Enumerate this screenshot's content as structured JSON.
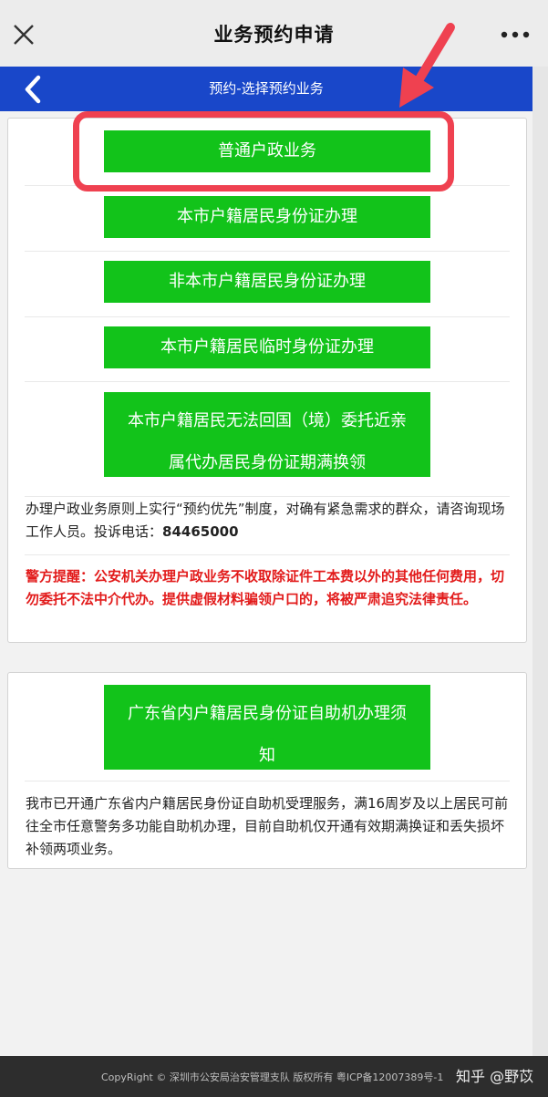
{
  "header": {
    "title": "业务预约申请",
    "close_icon": "close-icon",
    "more_icon": "more-icon"
  },
  "nav": {
    "title": "预约-选择预约业务",
    "back_icon": "chevron-left-icon",
    "background": "#1947c9"
  },
  "card1": {
    "buttons": [
      {
        "lines": [
          "普通户政业务"
        ]
      },
      {
        "lines": [
          "本市户籍居民身份证办理"
        ]
      },
      {
        "lines": [
          "非本市户籍居民身份证办理"
        ]
      },
      {
        "lines": [
          "本市户籍居民临时身份证办理"
        ]
      },
      {
        "lines": [
          "本市户籍居民无法回国（境）委托近亲",
          "属代办居民身份证期满换领"
        ]
      }
    ],
    "notice": "办理户政业务原则上实行“预约优先”制度，对确有紧急需求的群众，请咨询现场工作人员。投诉电话：",
    "phone": "84465000",
    "warning": "警方提醒：公安机关办理户政业务不收取除证件工本费以外的其他任何费用，切勿委托不法中介代办。提供虚假材料骗领户口的，将被严肃追究法律责任。"
  },
  "card2": {
    "button_lines": [
      "广东省内户籍居民身份证自助机办理须",
      "知"
    ],
    "notice": "我市已开通广东省内户籍居民身份证自助机受理服务，满16周岁及以上居民可前往全市任意警务多功能自助机办理，目前自助机仅开通有效期满换证和丢失损坏补领两项业务。"
  },
  "footer": {
    "copyright": "CopyRight © 深圳市公安局治安管理支队 版权所有 粤ICP备12007389号-1",
    "watermark": "知乎 @野苡"
  },
  "colors": {
    "button_green": "#12c31a",
    "highlight_red": "#ef4150",
    "warning_red": "#e21b1b"
  }
}
